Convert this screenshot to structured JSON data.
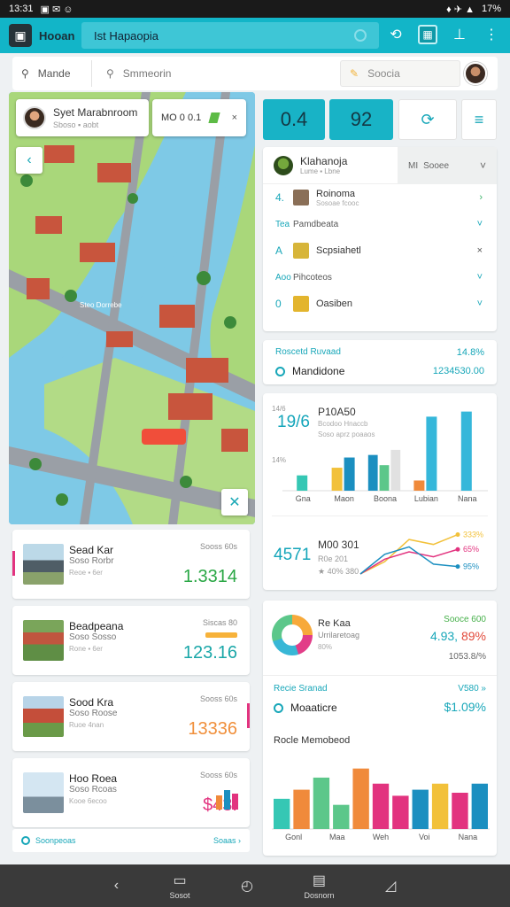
{
  "status_bar": {
    "time": "13:31",
    "icons_left": "▣ ✉ ☺",
    "battery": "17%",
    "icons_right": "♦ ✈ ▲"
  },
  "app_bar": {
    "title": "Hooan",
    "search_text": "Ist Hapaopia"
  },
  "top_row": {
    "field1": "Mande",
    "field2": "Smmeorin",
    "field3": "Soocia"
  },
  "map": {
    "card_title": "Syet Marabnroom",
    "card_sub": "Sboso ▪ aobt",
    "chip_text": "MO 0 0.1",
    "street_label": "Steo Dorrebe"
  },
  "tiles": [
    "0.4",
    "92"
  ],
  "user_list": {
    "header_title": "Klahanoja",
    "header_sub": "Lume ▪ Lbne",
    "filter": "Sooee",
    "filter_prefix": "MI",
    "rows": [
      {
        "ix": "4.",
        "title": "Roinoma",
        "sub": "Sosoae fcooc",
        "act": "›"
      },
      {
        "ix": "Tea",
        "title": "Pamdbeata",
        "sub": "",
        "act": "˅",
        "section": true
      },
      {
        "ix": "A",
        "title": "Scpsiahetl",
        "sub": "",
        "act": "×"
      },
      {
        "ix": "Aoo",
        "title": "Pihcoteos",
        "sub": "",
        "act": "˅",
        "section": true
      },
      {
        "ix": "0",
        "title": "Oasiben",
        "sub": "",
        "act": "˅"
      }
    ]
  },
  "metric_card": {
    "label": "Roscetd Ruvaad",
    "label_value": "14.8%",
    "title": "Mandidone",
    "value": "1234530.00"
  },
  "chart1": {
    "value": "19/6",
    "title": "P10A50",
    "sub": "Bcodoo Hnaccb",
    "sub2": "Soso aprz poaaos",
    "value2": "4571",
    "title2": "M00 301",
    "sub2a": "R0e 201",
    "sub2b": "★ 40% 380"
  },
  "chart2": {
    "title": "Re Kaa",
    "sub": "Urrilaretoag",
    "sub2": "80%",
    "right1": "Sooce 600",
    "right2_a": "4.93,",
    "right2_b": " 89%",
    "right3": "1053.8/%",
    "label1": "Recie Sranad",
    "label1_value": "V580 »",
    "title2": "Moaaticre",
    "value2": "$1.09%",
    "title3": "Rocle Memobeod"
  },
  "listings": [
    {
      "title": "Sead Kar",
      "sub": "Soso Rorbr",
      "sub2": "Reoe  ▪ 6er",
      "right": "Sooss 60s",
      "price": "1.3314",
      "price_color": "#2aa745",
      "accent": "#e2337f",
      "accent_side": "left",
      "bar": false
    },
    {
      "title": "Beadpeana",
      "sub": "Soso Sosso",
      "sub2": "Rone  ▪ 6er",
      "right": "Siscas 80",
      "price": "123.16",
      "price_color": "#1aa7a8",
      "accent": "",
      "accent_side": "",
      "bar": true
    },
    {
      "title": "Sood Kra",
      "sub": "Soso Roose",
      "sub2": "Ruoe 4nan",
      "right": "Sooss 60s",
      "price": "13336",
      "price_color": "#f08f3b",
      "accent": "#e2337f",
      "accent_side": "right",
      "bar": false
    },
    {
      "title": "Hoo Roea",
      "sub": "Soso Rcoas",
      "sub2": "Kooe 6ecoo",
      "right": "Sooss 60s",
      "price": "$43.",
      "price_color": "#e2337f",
      "accent": "",
      "accent_side": "",
      "bar": false
    }
  ],
  "footer_row": {
    "left": "Soonpeoas",
    "right": "Soaas ›"
  },
  "bottom_nav": [
    {
      "icon": "‹",
      "label": ""
    },
    {
      "icon": "▭",
      "label": "Sosot"
    },
    {
      "icon": "◴",
      "label": ""
    },
    {
      "icon": "▤",
      "label": "Dosnorn"
    },
    {
      "icon": "◿",
      "label": ""
    }
  ],
  "chart_data": [
    {
      "type": "bar",
      "title": "P10A50",
      "categories": [
        "Gna",
        "Maon",
        "Boona",
        "Lubian",
        "Nana"
      ],
      "series": [
        {
          "color": "#35c7b4",
          "values": [
            6,
            0,
            0,
            0,
            0
          ]
        },
        {
          "color": "#f2c13a",
          "values": [
            0,
            9,
            0,
            0,
            0
          ]
        },
        {
          "color": "#1b8fc0",
          "values": [
            0,
            13,
            14,
            0,
            0
          ]
        },
        {
          "color": "#5cc78a",
          "values": [
            0,
            0,
            10,
            0,
            0
          ]
        },
        {
          "color": "#e1e1e1",
          "values": [
            0,
            0,
            16,
            0,
            0
          ]
        },
        {
          "color": "#f08a3b",
          "values": [
            0,
            0,
            0,
            4,
            0
          ]
        },
        {
          "color": "#35b7da",
          "values": [
            0,
            0,
            0,
            29,
            31
          ]
        }
      ],
      "ylabel_top": "14/6",
      "ylabel_mid": "14%",
      "ylim": [
        0,
        34
      ]
    },
    {
      "type": "line",
      "title": "M00 301",
      "x": [
        0,
        1,
        2,
        3,
        4
      ],
      "series": [
        {
          "color": "#f2c13a",
          "label": "333%",
          "values": [
            0,
            5,
            14,
            12,
            16
          ]
        },
        {
          "color": "#e2337f",
          "label": "65%",
          "values": [
            0,
            6,
            9,
            7,
            10
          ]
        },
        {
          "color": "#1b8fc0",
          "label": "95%",
          "values": [
            0,
            8,
            11,
            4,
            3
          ]
        }
      ],
      "ylim": [
        0,
        18
      ]
    },
    {
      "type": "bar",
      "title": "Rocle Memobeod",
      "categories": [
        "Gonl",
        "Maa",
        "Weh",
        "Voi",
        "Nana"
      ],
      "values": [
        10,
        13,
        17,
        8,
        20,
        15,
        11,
        13,
        15,
        12,
        15
      ],
      "colors": [
        "#35c7b4",
        "#f08a3b",
        "#5cc78a",
        "#5cc78a",
        "#f08a3b",
        "#e2337f",
        "#e2337f",
        "#1b8fc0",
        "#f2c13a",
        "#e2337f",
        "#1b8fc0"
      ],
      "ylim": [
        0,
        24
      ]
    }
  ]
}
